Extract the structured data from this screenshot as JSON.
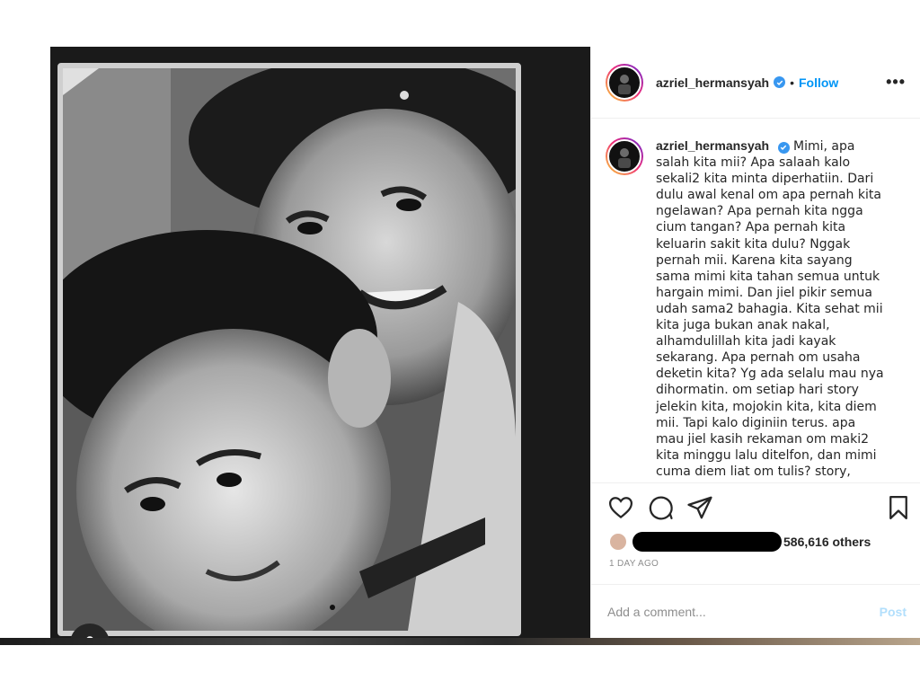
{
  "post": {
    "username": "azriel_hermansyah",
    "verified": true,
    "separator": "•",
    "follow_label": "Follow",
    "more_label": "•••"
  },
  "caption": {
    "username": "azriel_hermansyah",
    "text": "Mimi, apa salah kita mii? Apa salaah kalo sekali2 kita minta diperhatiin. Dari dulu awal kenal om apa pernah kita ngelawan? Apa pernah kita ngga cium tangan? Apa pernah kita keluarin sakit kita dulu? Nggak pernah mii. Karena kita sayang sama mimi kita tahan semua untuk hargain mimi. Dan jiel pikir semua udah sama2 bahagia. Kita sehat mii kita juga bukan anak nakal, alhamdulillah kita jadi kayak sekarang. Apa pernah om usaha deketin kita? Yg ada selalu mau nya dihormatin. om setiap hari story jelekin kita, mojokin kita, kita diem mii. Tapi kalo diginiin terus. apa mau jiel kasih rekaman om maki2 kita minggu lalu ditelfon, dan mimi cuma diem liat om tulis? story, mimi cuma"
  },
  "actions": {
    "like_icon": "heart-icon",
    "comment_icon": "comment-icon",
    "share_icon": "paper-plane-icon",
    "save_icon": "bookmark-icon"
  },
  "likes": {
    "count_text": "586,616 others"
  },
  "timestamp": "1 DAY AGO",
  "comment_box": {
    "placeholder": "Add a comment...",
    "post_label": "Post"
  },
  "colors": {
    "accent": "#0095f6",
    "verified": "#3897f0",
    "post_disabled": "#b2dffc"
  }
}
